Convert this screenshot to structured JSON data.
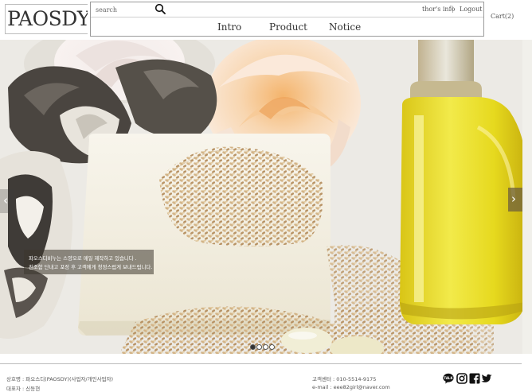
{
  "header": {
    "logo": "PAOSDY",
    "search_placeholder": "search",
    "util_info": "thor's info",
    "util_separator": "|",
    "util_logout": "Logout",
    "cart": "Cart(2)"
  },
  "nav": {
    "items": [
      {
        "label": "Intro"
      },
      {
        "label": "Product"
      },
      {
        "label": "Notice"
      }
    ]
  },
  "hero": {
    "caption_line_1": "파오스디비누는 스양오로 매일 제작하고 있습니다 .",
    "caption_line_2": "친조함 단내고 포장 후 고객에게 청정스럽게 보내드립니다.",
    "prev_arrow": "‹",
    "next_arrow": "›",
    "slide_count": 4,
    "active_slide": 1
  },
  "footer": {
    "company": "상호명 : 파오스디(PAOSDY)(사업자/개인사업자)",
    "ceo": "대표자 : 신동현",
    "center": "고객센터 : 010-5514-9175",
    "email": "e-mail : eee82girl@naver.com",
    "social": [
      "talk-icon",
      "instagram-icon",
      "facebook-icon",
      "twitter-icon"
    ]
  },
  "colors": {
    "border": "#9a9a9a",
    "oil": "#e4d81a",
    "soap": "#f4f1e6",
    "arrow": "#6e5f3c"
  }
}
